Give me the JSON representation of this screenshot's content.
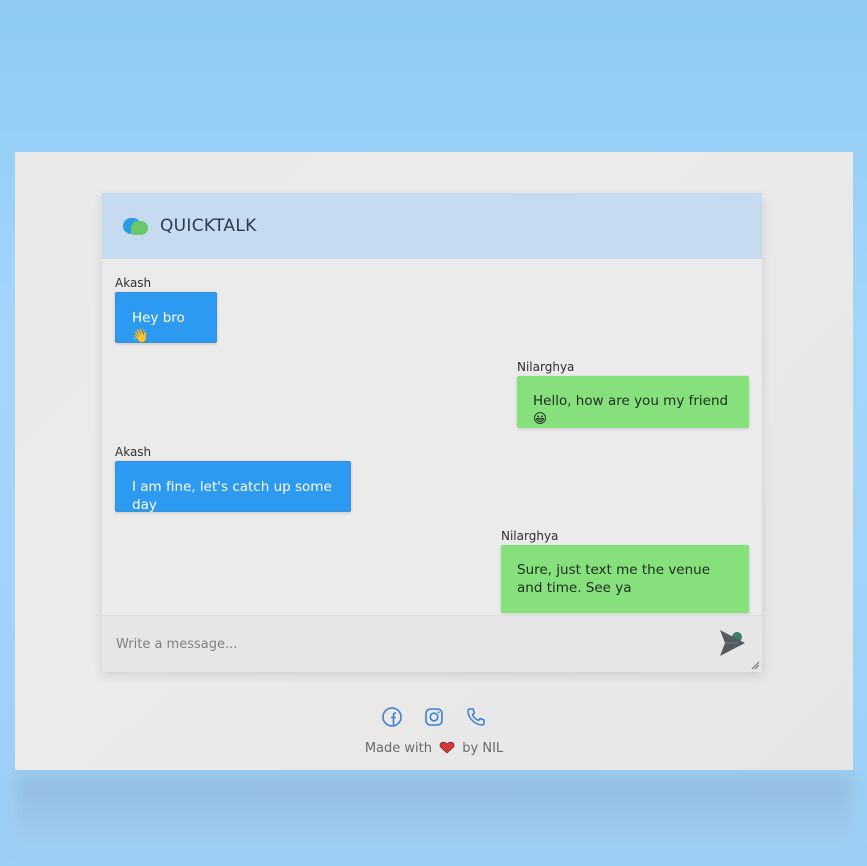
{
  "app": {
    "title": "QUICKTALK"
  },
  "messages": [
    {
      "sender": "Akash",
      "text": "Hey bro 👋",
      "side": "left"
    },
    {
      "sender": "Nilarghya",
      "text": "Hello, how are you my friend 😀",
      "side": "right"
    },
    {
      "sender": "Akash",
      "text": "I am fine, let's catch up some day",
      "side": "left"
    },
    {
      "sender": "Nilarghya",
      "text": "Sure, just text me the venue and time. See ya",
      "side": "right"
    }
  ],
  "composer": {
    "placeholder": "Write a message..."
  },
  "footer": {
    "icons": [
      "facebook-icon",
      "instagram-icon",
      "phone-icon"
    ],
    "made_with": "Made with",
    "by": "by NIL"
  },
  "colors": {
    "left_bubble": "#2b9af0",
    "right_bubble": "#86e07b",
    "header": "#c7dbf0",
    "icon_blue": "#3b7fd1"
  }
}
